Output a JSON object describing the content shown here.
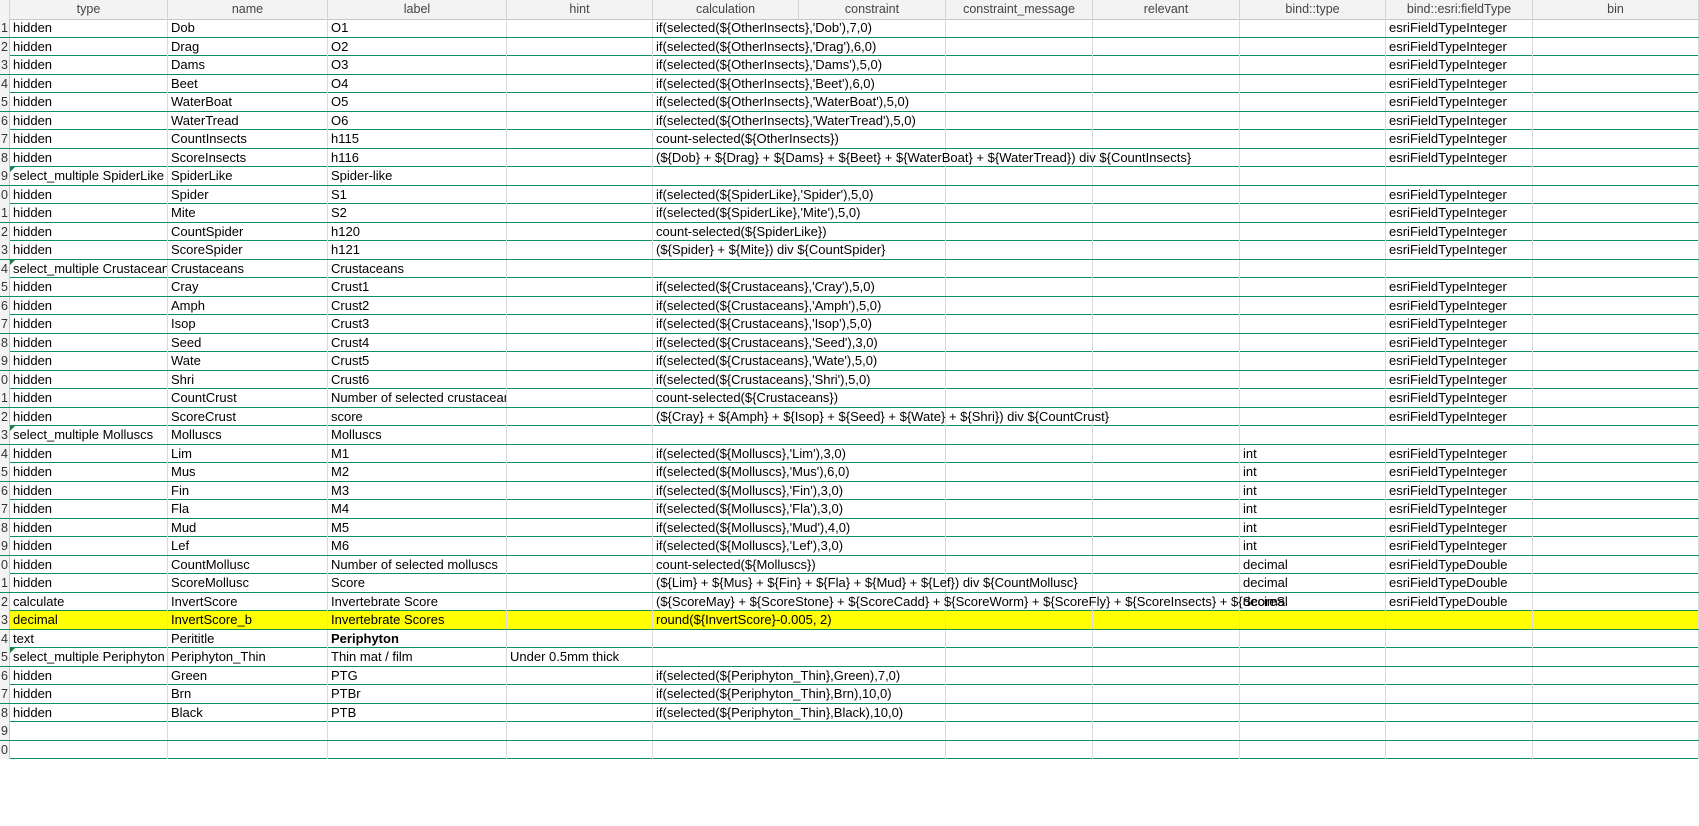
{
  "columns": [
    "",
    "type",
    "name",
    "label",
    "hint",
    "calculation",
    "constraint",
    "constraint_message",
    "relevant",
    "bind::type",
    "bind::esri:fieldType",
    "bin"
  ],
  "rows": [
    {
      "num": "1",
      "type": "hidden",
      "name": "Dob",
      "label": "O1",
      "hint": "",
      "calculation": "if(selected(${OtherInsects},'Dob'),7,0)",
      "bind_type": "",
      "field_type": "esriFieldTypeInteger"
    },
    {
      "num": "2",
      "type": "hidden",
      "name": "Drag",
      "label": "O2",
      "hint": "",
      "calculation": "if(selected(${OtherInsects},'Drag'),6,0)",
      "bind_type": "",
      "field_type": "esriFieldTypeInteger"
    },
    {
      "num": "3",
      "type": "hidden",
      "name": "Dams",
      "label": "O3",
      "hint": "",
      "calculation": "if(selected(${OtherInsects},'Dams'),5,0)",
      "bind_type": "",
      "field_type": "esriFieldTypeInteger"
    },
    {
      "num": "4",
      "type": "hidden",
      "name": "Beet",
      "label": "O4",
      "hint": "",
      "calculation": "if(selected(${OtherInsects},'Beet'),6,0)",
      "bind_type": "",
      "field_type": "esriFieldTypeInteger"
    },
    {
      "num": "5",
      "type": "hidden",
      "name": "WaterBoat",
      "label": "O5",
      "hint": "",
      "calculation": "if(selected(${OtherInsects},'WaterBoat'),5,0)",
      "bind_type": "",
      "field_type": "esriFieldTypeInteger"
    },
    {
      "num": "6",
      "type": "hidden",
      "name": "WaterTread",
      "label": "O6",
      "hint": "",
      "calculation": "if(selected(${OtherInsects},'WaterTread'),5,0)",
      "bind_type": "",
      "field_type": "esriFieldTypeInteger"
    },
    {
      "num": "7",
      "type": "hidden",
      "name": "CountInsects",
      "label": "h115",
      "hint": "",
      "calculation": "count-selected(${OtherInsects})",
      "bind_type": "",
      "field_type": "esriFieldTypeInteger"
    },
    {
      "num": "8",
      "type": "hidden",
      "name": "ScoreInsects",
      "label": "h116",
      "hint": "",
      "calculation": "(${Dob} + ${Drag} + ${Dams} + ${Beet} + ${WaterBoat} + ${WaterTread}) div ${CountInsects}",
      "bind_type": "",
      "field_type": "esriFieldTypeInteger"
    },
    {
      "num": "9",
      "type": "select_multiple SpiderLike",
      "name": "SpiderLike",
      "label": "Spider-like",
      "hint": "",
      "calculation": "",
      "bind_type": "",
      "field_type": "",
      "mark": true
    },
    {
      "num": "0",
      "type": "hidden",
      "name": "Spider",
      "label": "S1",
      "hint": "",
      "calculation": "if(selected(${SpiderLike},'Spider'),5,0)",
      "bind_type": "",
      "field_type": "esriFieldTypeInteger"
    },
    {
      "num": "1",
      "type": "hidden",
      "name": "Mite",
      "label": "S2",
      "hint": "",
      "calculation": "if(selected(${SpiderLike},'Mite'),5,0)",
      "bind_type": "",
      "field_type": "esriFieldTypeInteger"
    },
    {
      "num": "2",
      "type": "hidden",
      "name": "CountSpider",
      "label": "h120",
      "hint": "",
      "calculation": "count-selected(${SpiderLike})",
      "bind_type": "",
      "field_type": "esriFieldTypeInteger"
    },
    {
      "num": "3",
      "type": "hidden",
      "name": "ScoreSpider",
      "label": "h121",
      "hint": "",
      "calculation": "(${Spider} + ${Mite}) div ${CountSpider}",
      "bind_type": "",
      "field_type": "esriFieldTypeInteger"
    },
    {
      "num": "4",
      "type": "select_multiple Crustaceans",
      "name": "Crustaceans",
      "label": "Crustaceans",
      "hint": "",
      "calculation": "",
      "bind_type": "",
      "field_type": "",
      "mark": true
    },
    {
      "num": "5",
      "type": "hidden",
      "name": "Cray",
      "label": "Crust1",
      "hint": "",
      "calculation": "if(selected(${Crustaceans},'Cray'),5,0)",
      "bind_type": "",
      "field_type": "esriFieldTypeInteger"
    },
    {
      "num": "6",
      "type": "hidden",
      "name": "Amph",
      "label": "Crust2",
      "hint": "",
      "calculation": "if(selected(${Crustaceans},'Amph'),5,0)",
      "bind_type": "",
      "field_type": "esriFieldTypeInteger"
    },
    {
      "num": "7",
      "type": "hidden",
      "name": "Isop",
      "label": "Crust3",
      "hint": "",
      "calculation": "if(selected(${Crustaceans},'Isop'),5,0)",
      "bind_type": "",
      "field_type": "esriFieldTypeInteger"
    },
    {
      "num": "8",
      "type": "hidden",
      "name": "Seed",
      "label": "Crust4",
      "hint": "",
      "calculation": "if(selected(${Crustaceans},'Seed'),3,0)",
      "bind_type": "",
      "field_type": "esriFieldTypeInteger"
    },
    {
      "num": "9",
      "type": "hidden",
      "name": "Wate",
      "label": "Crust5",
      "hint": "",
      "calculation": "if(selected(${Crustaceans},'Wate'),5,0)",
      "bind_type": "",
      "field_type": "esriFieldTypeInteger"
    },
    {
      "num": "0",
      "type": "hidden",
      "name": "Shri",
      "label": "Crust6",
      "hint": "",
      "calculation": "if(selected(${Crustaceans},'Shri'),5,0)",
      "bind_type": "",
      "field_type": "esriFieldTypeInteger"
    },
    {
      "num": "1",
      "type": "hidden",
      "name": "CountCrust",
      "label": "Number of selected crustaceans",
      "hint": "",
      "calculation": "count-selected(${Crustaceans})",
      "bind_type": "",
      "field_type": "esriFieldTypeInteger"
    },
    {
      "num": "2",
      "type": "hidden",
      "name": "ScoreCrust",
      "label": "score",
      "hint": "",
      "calculation": "(${Cray} + ${Amph} + ${Isop} + ${Seed} + ${Wate} + ${Shri}) div ${CountCrust}",
      "bind_type": "",
      "field_type": "esriFieldTypeInteger"
    },
    {
      "num": "3",
      "type": "select_multiple Molluscs",
      "name": "Molluscs",
      "label": "Molluscs",
      "hint": "",
      "calculation": "",
      "bind_type": "",
      "field_type": "",
      "mark": true
    },
    {
      "num": "4",
      "type": "hidden",
      "name": "Lim",
      "label": "M1",
      "hint": "",
      "calculation": "if(selected(${Molluscs},'Lim'),3,0)",
      "bind_type": "int",
      "field_type": "esriFieldTypeInteger"
    },
    {
      "num": "5",
      "type": "hidden",
      "name": "Mus",
      "label": "M2",
      "hint": "",
      "calculation": "if(selected(${Molluscs},'Mus'),6,0)",
      "bind_type": "int",
      "field_type": "esriFieldTypeInteger"
    },
    {
      "num": "6",
      "type": "hidden",
      "name": "Fin",
      "label": "M3",
      "hint": "",
      "calculation": "if(selected(${Molluscs},'Fin'),3,0)",
      "bind_type": "int",
      "field_type": "esriFieldTypeInteger"
    },
    {
      "num": "7",
      "type": "hidden",
      "name": "Fla",
      "label": "M4",
      "hint": "",
      "calculation": "if(selected(${Molluscs},'Fla'),3,0)",
      "bind_type": "int",
      "field_type": "esriFieldTypeInteger"
    },
    {
      "num": "8",
      "type": "hidden",
      "name": "Mud",
      "label": "M5",
      "hint": "",
      "calculation": "if(selected(${Molluscs},'Mud'),4,0)",
      "bind_type": "int",
      "field_type": "esriFieldTypeInteger"
    },
    {
      "num": "9",
      "type": "hidden",
      "name": "Lef",
      "label": "M6",
      "hint": "",
      "calculation": "if(selected(${Molluscs},'Lef'),3,0)",
      "bind_type": "int",
      "field_type": "esriFieldTypeInteger"
    },
    {
      "num": "0",
      "type": "hidden",
      "name": "CountMollusc",
      "label": "Number of selected molluscs",
      "hint": "",
      "calculation": "count-selected(${Molluscs})",
      "bind_type": "decimal",
      "field_type": "esriFieldTypeDouble"
    },
    {
      "num": "1",
      "type": "hidden",
      "name": "ScoreMollusc",
      "label": "Score",
      "hint": "",
      "calculation": "(${Lim} + ${Mus} + ${Fin} + ${Fla} + ${Mud} + ${Lef}) div ${CountMollusc}",
      "bind_type": "decimal",
      "field_type": "esriFieldTypeDouble"
    },
    {
      "num": "2",
      "type": "calculate",
      "name": "InvertScore",
      "label": "Invertebrate Score",
      "hint": "",
      "calculation": "(${ScoreMay} + ${ScoreStone} + ${ScoreCadd} + ${ScoreWorm} + ${ScoreFly} + ${ScoreInsects} + ${ScoreS",
      "bind_type": "decimal",
      "field_type": "esriFieldTypeDouble"
    },
    {
      "num": "3",
      "type": "decimal",
      "name": "InvertScore_b",
      "label": "Invertebrate Scores",
      "hint": "",
      "calculation": "round(${InvertScore}-0.005, 2)",
      "bind_type": "",
      "field_type": "",
      "highlight": true
    },
    {
      "num": "4",
      "type": "text",
      "name": "Perititle",
      "label": "Periphyton",
      "hint": "",
      "calculation": "",
      "bind_type": "",
      "field_type": "",
      "bold_label": true
    },
    {
      "num": "5",
      "type": "select_multiple Periphyton",
      "name": "Periphyton_Thin",
      "label": "Thin mat / film",
      "hint": "Under 0.5mm thick",
      "calculation": "",
      "bind_type": "",
      "field_type": "",
      "mark": true
    },
    {
      "num": "6",
      "type": "hidden",
      "name": "Green",
      "label": "PTG",
      "hint": "",
      "calculation": "if(selected(${Periphyton_Thin},Green),7,0)",
      "bind_type": "",
      "field_type": ""
    },
    {
      "num": "7",
      "type": "hidden",
      "name": "Brn",
      "label": "PTBr",
      "hint": "",
      "calculation": "if(selected(${Periphyton_Thin},Brn),10,0)",
      "bind_type": "",
      "field_type": ""
    },
    {
      "num": "8",
      "type": "hidden",
      "name": "Black",
      "label": "PTB",
      "hint": "",
      "calculation": "if(selected(${Periphyton_Thin},Black),10,0)",
      "bind_type": "",
      "field_type": ""
    },
    {
      "num": "9",
      "type": "",
      "name": "",
      "label": "",
      "hint": "",
      "calculation": "",
      "bind_type": "",
      "field_type": ""
    },
    {
      "num": "0",
      "type": "",
      "name": "",
      "label": "",
      "hint": "",
      "calculation": "",
      "bind_type": "",
      "field_type": ""
    }
  ],
  "colors": {
    "highlight": "#ffff00",
    "row_border": "#0f8f5a",
    "comment_marker": "#1e7b45",
    "header_bg": "#f3f3f3"
  }
}
